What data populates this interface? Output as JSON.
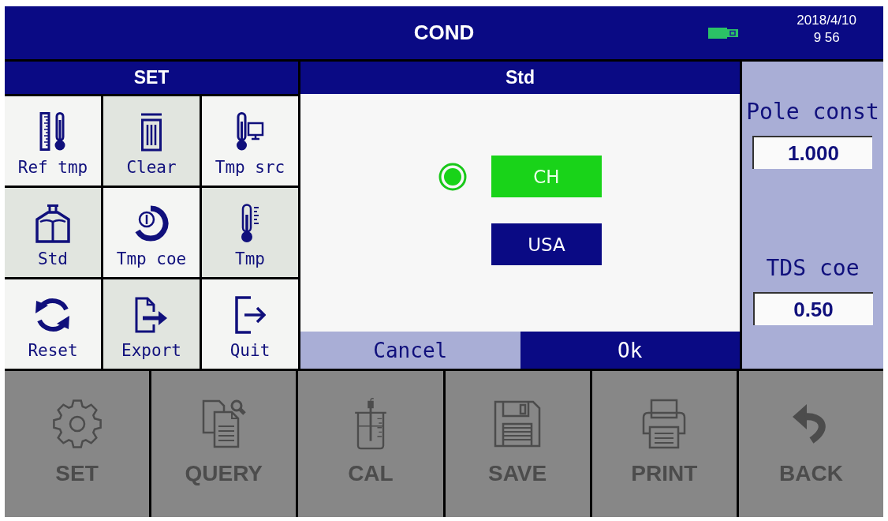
{
  "title_bar": {
    "title": "COND",
    "date": "2018/4/10",
    "time": "9 56"
  },
  "set_panel": {
    "title": "SET",
    "items": [
      {
        "label": "Ref tmp"
      },
      {
        "label": "Clear"
      },
      {
        "label": "Tmp src"
      },
      {
        "label": "Std"
      },
      {
        "label": "Tmp coe"
      },
      {
        "label": "Tmp"
      },
      {
        "label": "Reset"
      },
      {
        "label": "Export"
      },
      {
        "label": "Quit"
      }
    ]
  },
  "dialog": {
    "title": "Std",
    "options": [
      {
        "label": "CH",
        "selected": true
      },
      {
        "label": "USA",
        "selected": false
      }
    ],
    "buttons": [
      {
        "label": "Cancel",
        "selected": false
      },
      {
        "label": "Ok",
        "selected": true
      }
    ]
  },
  "parameters": [
    {
      "label": "Pole const",
      "value": "1.000"
    },
    {
      "label": "TDS coe",
      "value": "0.50"
    }
  ],
  "bottom_menu": [
    {
      "label": "SET",
      "disabled": true
    },
    {
      "label": "QUERY",
      "disabled": true
    },
    {
      "label": "CAL",
      "disabled": true
    },
    {
      "label": "SAVE",
      "disabled": true
    },
    {
      "label": "PRINT",
      "disabled": true
    },
    {
      "label": "BACK",
      "disabled": true
    }
  ]
}
